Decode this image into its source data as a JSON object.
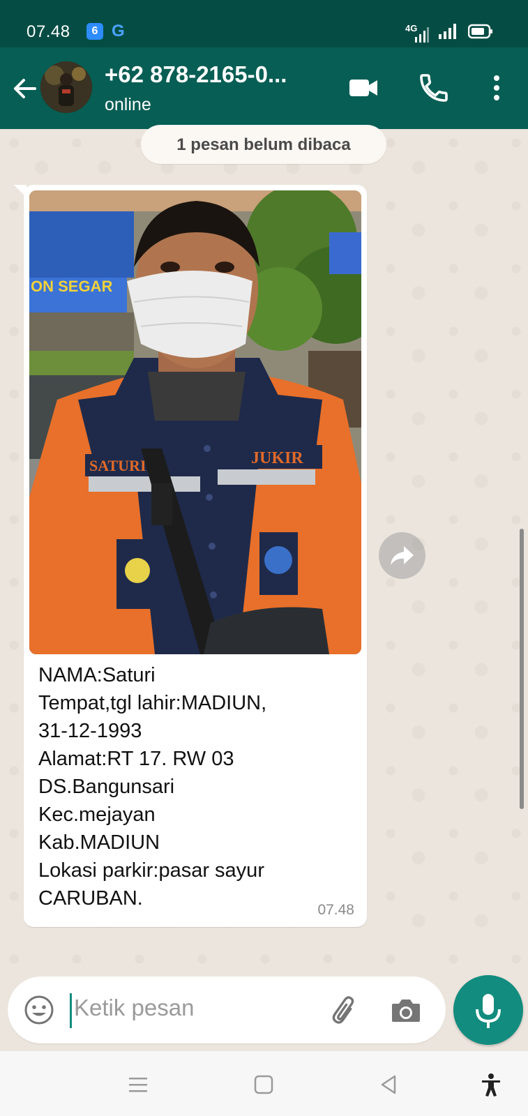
{
  "status_bar": {
    "time": "07.48",
    "app_icon_1": "6",
    "app_icon_2": "G",
    "network": "4G"
  },
  "header": {
    "contact_name": "+62 878-2165-0...",
    "contact_status": "online"
  },
  "chat": {
    "unread_notice": "1 pesan belum dibaca",
    "message": {
      "text": "NAMA:Saturi\nTempat,tgl lahir:MADIUN,\n31-12-1993\nAlamat:RT 17. RW 03\n              DS.Bangunsari\n              Kec.mejayan\n              Kab.MADIUN\nLokasi parkir:pasar sayur\nCARUBAN.",
      "time": "07.48",
      "photo_labels": {
        "left_badge": "SATURI",
        "right_badge": "JUKIR",
        "shop_sign": "ON SEGAR"
      }
    }
  },
  "input": {
    "placeholder": "Ketik pesan"
  },
  "colors": {
    "header": "#075e54",
    "status_bar": "#054d44",
    "accent": "#128c7e",
    "bubble": "#ffffff",
    "chat_bg": "#ece5dd"
  },
  "icons": {
    "back": "arrow-left-icon",
    "video": "video-camera-icon",
    "call": "phone-icon",
    "menu": "more-vert-icon",
    "forward": "forward-icon",
    "emoji": "emoji-icon",
    "attach": "paperclip-icon",
    "camera": "camera-icon",
    "mic": "microphone-icon"
  }
}
